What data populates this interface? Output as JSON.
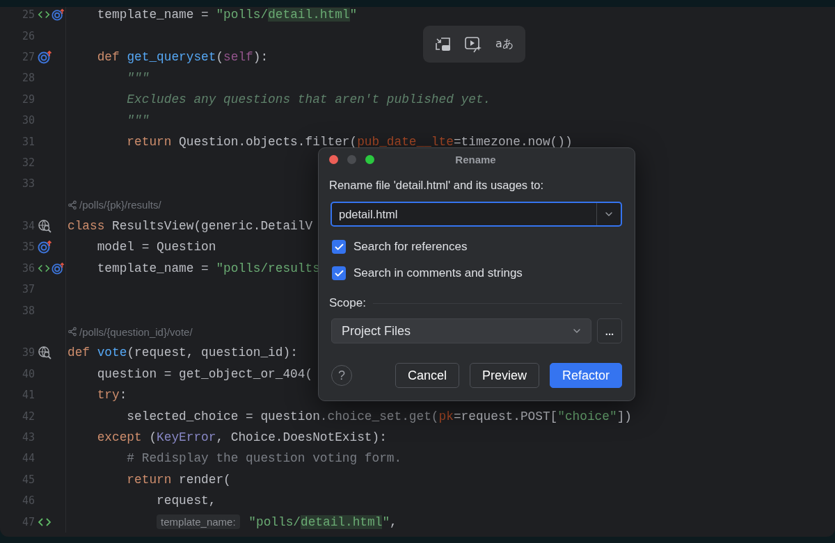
{
  "editor": {
    "rows": [
      {
        "kind": "code",
        "number": "25",
        "gutter": [
          {
            "kind": "markup"
          },
          {
            "kind": "override"
          }
        ],
        "tokens": [
          {
            "kind": "plain",
            "s": "    template_name = "
          },
          {
            "kind": "string",
            "s": "\"polls/"
          },
          {
            "kind": "string-hl",
            "s": "detail.html"
          },
          {
            "kind": "string",
            "s": "\""
          }
        ]
      },
      {
        "kind": "code",
        "number": "26",
        "gutter": [],
        "tokens": []
      },
      {
        "kind": "code",
        "number": "27",
        "gutter": [
          {
            "kind": "override"
          }
        ],
        "tokens": [
          {
            "kind": "keyword",
            "s": "    def "
          },
          {
            "kind": "function",
            "s": "get_queryset"
          },
          {
            "kind": "plain",
            "s": "("
          },
          {
            "kind": "self",
            "s": "self"
          },
          {
            "kind": "plain",
            "s": "):"
          }
        ]
      },
      {
        "kind": "code",
        "number": "28",
        "gutter": [],
        "tokens": [
          {
            "kind": "docstring",
            "s": "        \"\"\""
          }
        ]
      },
      {
        "kind": "code",
        "number": "29",
        "gutter": [],
        "tokens": [
          {
            "kind": "docstring",
            "s": "        Excludes any questions that aren't published yet."
          }
        ]
      },
      {
        "kind": "code",
        "number": "30",
        "gutter": [],
        "tokens": [
          {
            "kind": "docstring",
            "s": "        \"\"\""
          }
        ]
      },
      {
        "kind": "code",
        "number": "31",
        "gutter": [],
        "tokens": [
          {
            "kind": "keyword",
            "s": "        return "
          },
          {
            "kind": "plain",
            "s": "Question.objects.filter("
          },
          {
            "kind": "param",
            "s": "pub_date__lte"
          },
          {
            "kind": "plain",
            "s": "=timezone.now())"
          }
        ]
      },
      {
        "kind": "code",
        "number": "32",
        "gutter": [],
        "tokens": []
      },
      {
        "kind": "code",
        "number": "33",
        "gutter": [],
        "tokens": []
      },
      {
        "kind": "route",
        "text": "/polls/{pk}/results/"
      },
      {
        "kind": "code",
        "number": "34",
        "gutter": [
          {
            "kind": "endpoint"
          }
        ],
        "tokens": [
          {
            "kind": "keyword",
            "s": "class "
          },
          {
            "kind": "plain",
            "s": "ResultsView(generic.DetailV"
          }
        ]
      },
      {
        "kind": "code",
        "number": "35",
        "gutter": [
          {
            "kind": "override"
          }
        ],
        "tokens": [
          {
            "kind": "plain",
            "s": "    model = Question"
          }
        ]
      },
      {
        "kind": "code",
        "number": "36",
        "gutter": [
          {
            "kind": "markup"
          },
          {
            "kind": "override"
          }
        ],
        "tokens": [
          {
            "kind": "plain",
            "s": "    template_name = "
          },
          {
            "kind": "string",
            "s": "\"polls/results"
          }
        ]
      },
      {
        "kind": "code",
        "number": "37",
        "gutter": [],
        "tokens": []
      },
      {
        "kind": "code",
        "number": "38",
        "gutter": [],
        "tokens": []
      },
      {
        "kind": "route",
        "text": "/polls/{question_id}/vote/"
      },
      {
        "kind": "code",
        "number": "39",
        "gutter": [
          {
            "kind": "endpoint"
          }
        ],
        "tokens": [
          {
            "kind": "keyword",
            "s": "def "
          },
          {
            "kind": "function",
            "s": "vote"
          },
          {
            "kind": "plain",
            "s": "(request, question_id):"
          }
        ]
      },
      {
        "kind": "code",
        "number": "40",
        "gutter": [],
        "tokens": [
          {
            "kind": "plain",
            "s": "    question = get_object_or_404("
          }
        ]
      },
      {
        "kind": "code",
        "number": "41",
        "gutter": [],
        "tokens": [
          {
            "kind": "keyword",
            "s": "    try"
          },
          {
            "kind": "plain",
            "s": ":"
          }
        ]
      },
      {
        "kind": "code",
        "number": "42",
        "gutter": [],
        "tokens": [
          {
            "kind": "plain",
            "s": "        selected_choice = question"
          },
          {
            "kind": "dim",
            "s": ".choice_set.get("
          },
          {
            "kind": "param",
            "s": "pk"
          },
          {
            "kind": "plain",
            "s": "=request.POST["
          },
          {
            "kind": "string",
            "s": "\"choice\""
          },
          {
            "kind": "plain",
            "s": "])"
          }
        ]
      },
      {
        "kind": "code",
        "number": "43",
        "gutter": [],
        "tokens": [
          {
            "kind": "keyword",
            "s": "    except "
          },
          {
            "kind": "plain",
            "s": "("
          },
          {
            "kind": "builtin",
            "s": "KeyError"
          },
          {
            "kind": "plain",
            "s": ", Choice.DoesNotExist):"
          }
        ]
      },
      {
        "kind": "code",
        "number": "44",
        "gutter": [],
        "tokens": [
          {
            "kind": "comment",
            "s": "        # Redisplay the question voting form."
          }
        ]
      },
      {
        "kind": "code",
        "number": "45",
        "gutter": [],
        "tokens": [
          {
            "kind": "keyword",
            "s": "        return "
          },
          {
            "kind": "plain",
            "s": "render("
          }
        ]
      },
      {
        "kind": "code",
        "number": "46",
        "gutter": [],
        "tokens": [
          {
            "kind": "plain",
            "s": "            request,"
          }
        ]
      },
      {
        "kind": "code",
        "number": "47",
        "gutter": [
          {
            "kind": "markup"
          }
        ],
        "tokens": [
          {
            "kind": "hint",
            "s": "template_name:"
          },
          {
            "kind": "string",
            "s": " \"polls/"
          },
          {
            "kind": "string-hl",
            "s": "detail.html"
          },
          {
            "kind": "string",
            "s": "\""
          },
          {
            "kind": "plain",
            "s": ","
          }
        ],
        "indent": "            "
      }
    ]
  },
  "toolbar": [
    {
      "kind": "pip"
    },
    {
      "kind": "video-ai"
    },
    {
      "kind": "text",
      "label": "aあ"
    }
  ],
  "dialog": {
    "title": "Rename",
    "prompt": "Rename file 'detail.html' and its usages to:",
    "field": {
      "value": "pdetail.html"
    },
    "options": [
      {
        "label": "Search for references",
        "checked": true
      },
      {
        "label": "Search in comments and strings",
        "checked": true
      }
    ],
    "scope_label": "Scope:",
    "scope": {
      "value": "Project Files"
    },
    "more": "...",
    "help": "?",
    "buttons": [
      {
        "label": "Cancel",
        "kind": "secondary"
      },
      {
        "label": "Preview",
        "kind": "secondary"
      },
      {
        "label": "Refactor",
        "kind": "primary"
      }
    ]
  }
}
